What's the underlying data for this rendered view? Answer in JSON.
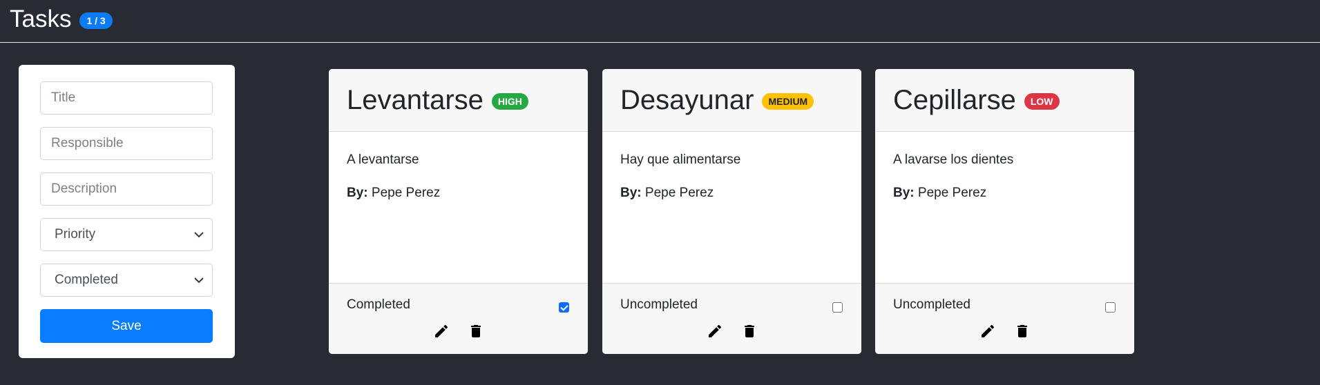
{
  "header": {
    "title": "Tasks",
    "count_badge": "1 / 3"
  },
  "form": {
    "title_placeholder": "Title",
    "responsible_placeholder": "Responsible",
    "description_placeholder": "Description",
    "priority_selected": "Priority",
    "completed_selected": "Completed",
    "save_label": "Save"
  },
  "colors": {
    "background": "#282b33",
    "accent": "#0a7cff",
    "high": "#28a745",
    "medium": "#ffc107",
    "low": "#dc3545"
  },
  "tasks": [
    {
      "title": "Levantarse",
      "priority": "HIGH",
      "priority_color": "#28a745",
      "priority_text_color": "#ffffff",
      "description": "A levantarse",
      "by_label": "By:",
      "responsible": "Pepe Perez",
      "status": "Completed",
      "checked": true
    },
    {
      "title": "Desayunar",
      "priority": "MEDIUM",
      "priority_color": "#ffc107",
      "priority_text_color": "#212529",
      "description": "Hay que alimentarse",
      "by_label": "By:",
      "responsible": "Pepe Perez",
      "status": "Uncompleted",
      "checked": false
    },
    {
      "title": "Cepillarse",
      "priority": "LOW",
      "priority_color": "#dc3545",
      "priority_text_color": "#ffffff",
      "description": "A lavarse los dientes",
      "by_label": "By:",
      "responsible": "Pepe Perez",
      "status": "Uncompleted",
      "checked": false
    }
  ],
  "icons": {
    "edit": "pencil-icon",
    "delete": "trash-icon"
  }
}
